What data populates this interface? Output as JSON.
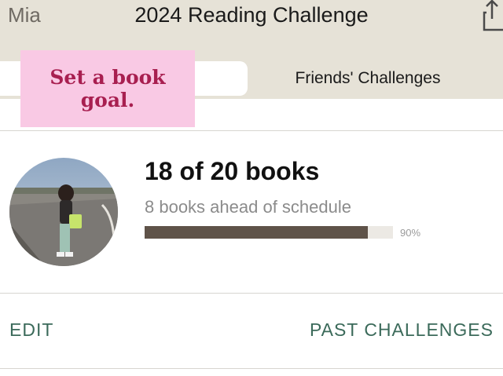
{
  "header": {
    "back_label": "Mia",
    "title": "2024 Reading Challenge",
    "share_icon": "share-icon"
  },
  "tabs": {
    "friends_label": "Friends' Challenges"
  },
  "sticker": {
    "text": "Set a book\ngoal."
  },
  "challenge": {
    "books_text": "18 of 20 books",
    "ahead_text": "8 books ahead of schedule",
    "progress_fraction": 0.9,
    "percent_label": "90%"
  },
  "actions": {
    "edit_label": "EDIT",
    "past_label": "PAST CHALLENGES"
  },
  "colors": {
    "accent_green": "#3b6a5a",
    "progress_fill": "#5f5349",
    "sticker_bg": "#f9c9e4",
    "sticker_text": "#a81f50"
  }
}
